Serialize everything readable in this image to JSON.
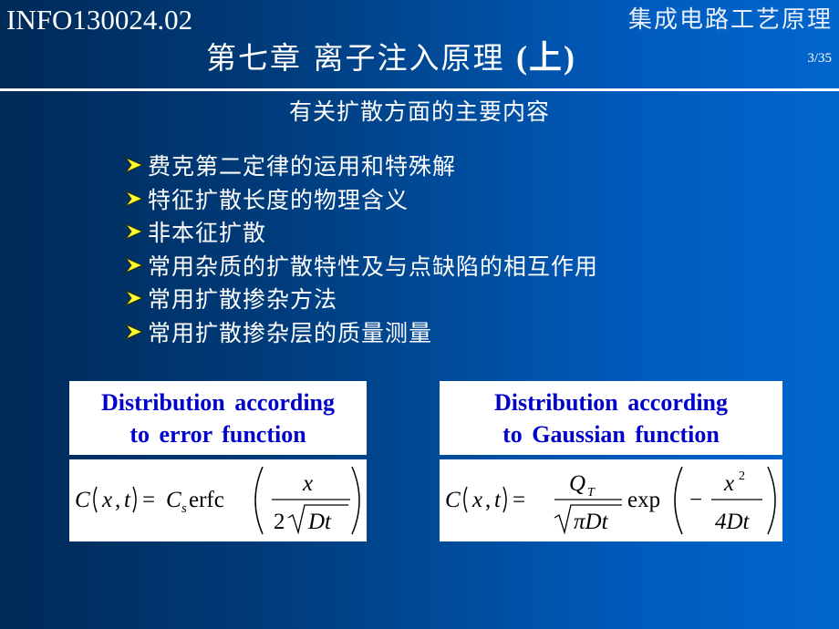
{
  "header": {
    "course_code": "INFO130024.02",
    "course_name": "集成电路工艺原理",
    "chapter_title_cn": "第七章 离子注入原理 ",
    "chapter_title_suffix": "(上)",
    "page_number": "3/35"
  },
  "section": {
    "heading": "有关扩散方面的主要内容",
    "bullet_icon": "yellow-arrowhead",
    "items": [
      {
        "label": "费克第二定律的运用和特殊解"
      },
      {
        "label": "特征扩散长度的物理含义"
      },
      {
        "label": "非本征扩散"
      },
      {
        "label": "常用杂质的扩散特性及与点缺陷的相互作用"
      },
      {
        "label": "常用扩散掺杂方法"
      },
      {
        "label": "常用扩散掺杂层的质量测量"
      }
    ]
  },
  "cards": {
    "error_function": {
      "title_line1": "Distribution  according",
      "title_line2": "to error  function",
      "formula": {
        "lhs": "C(x, t)",
        "equals": "=",
        "coefficient": "C",
        "coefficient_subscript": "s",
        "function": "erfc",
        "numerator": "x",
        "denominator_factor": "2",
        "denominator_radicand": "Dt"
      }
    },
    "gaussian_function": {
      "title_line1": "Distribution  according",
      "title_line2": "to Gaussian  function",
      "formula": {
        "lhs": "C(x, t)",
        "equals": "=",
        "numerator": "Q",
        "numerator_subscript": "T",
        "denominator_radicand": "πDt",
        "function": "exp",
        "sign": "−",
        "inner_numerator": "x",
        "inner_numerator_exponent": "2",
        "inner_denominator": "4Dt"
      }
    }
  },
  "colors": {
    "background_left": "#002a58",
    "background_right": "#0066cc",
    "bullet_arrow": "#ffff33",
    "card_title_text": "#0000cc",
    "card_background": "#ffffff"
  }
}
